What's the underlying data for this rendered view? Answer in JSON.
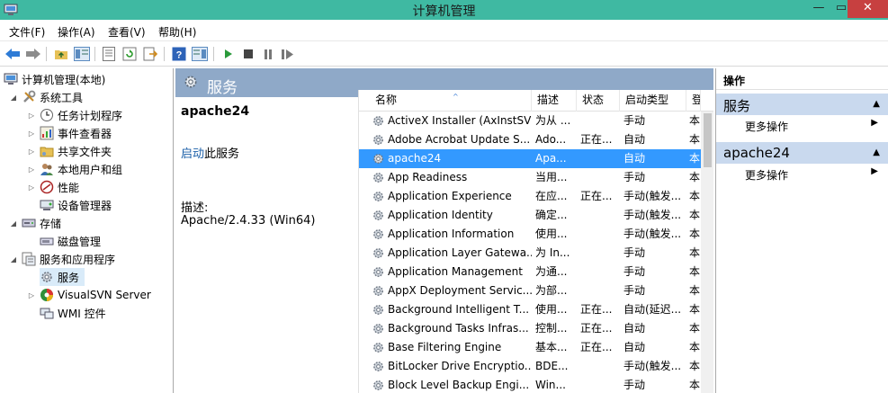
{
  "window": {
    "title": "计算机管理",
    "minimize_glyph": "—",
    "maximize_glyph": "▭",
    "close_glyph": "✕"
  },
  "menu": [
    "文件(F)",
    "操作(A)",
    "查看(V)",
    "帮助(H)"
  ],
  "toolbar_icons": [
    "back-icon",
    "forward-icon",
    "up-folder-icon",
    "show-hide-tree-icon",
    "properties-icon",
    "refresh-icon",
    "export-list-icon",
    "help-icon",
    "show-action-pane-icon",
    "start-service-icon",
    "stop-service-icon",
    "pause-service-icon",
    "restart-service-icon"
  ],
  "tree": {
    "root": "计算机管理(本地)",
    "system_tools": "系统工具",
    "task_scheduler": "任务计划程序",
    "event_viewer": "事件查看器",
    "shared_folders": "共享文件夹",
    "local_users": "本地用户和组",
    "performance": "性能",
    "device_manager": "设备管理器",
    "storage": "存储",
    "disk_management": "磁盘管理",
    "services_apps": "服务和应用程序",
    "services": "服务",
    "visualsvn": "VisualSVN Server",
    "wmi": "WMI 控件",
    "expanded_glyph": "◢",
    "collapsed_glyph": "▷"
  },
  "services_panel": {
    "header": "服务",
    "selected_name": "apache24",
    "start_link": "启动",
    "start_suffix": "此服务",
    "desc_label": "描述:",
    "desc": "Apache/2.4.33 (Win64)",
    "sort_glyph": "^",
    "columns": [
      "名称",
      "描述",
      "状态",
      "启动类型",
      "登"
    ],
    "rows": [
      {
        "name": "ActiveX Installer (AxInstSV)",
        "desc": "为从 ...",
        "status": "",
        "start": "手动",
        "login": "本"
      },
      {
        "name": "Adobe Acrobat Update S...",
        "desc": "Ado...",
        "status": "正在...",
        "start": "自动",
        "login": "本"
      },
      {
        "name": "apache24",
        "desc": "Apa...",
        "status": "",
        "start": "自动",
        "login": "本"
      },
      {
        "name": "App Readiness",
        "desc": "当用...",
        "status": "",
        "start": "手动",
        "login": "本"
      },
      {
        "name": "Application Experience",
        "desc": "在应...",
        "status": "正在...",
        "start": "手动(触发...",
        "login": "本"
      },
      {
        "name": "Application Identity",
        "desc": "确定...",
        "status": "",
        "start": "手动(触发...",
        "login": "本"
      },
      {
        "name": "Application Information",
        "desc": "使用...",
        "status": "",
        "start": "手动(触发...",
        "login": "本"
      },
      {
        "name": "Application Layer Gatewa...",
        "desc": "为 In...",
        "status": "",
        "start": "手动",
        "login": "本"
      },
      {
        "name": "Application Management",
        "desc": "为通...",
        "status": "",
        "start": "手动",
        "login": "本"
      },
      {
        "name": "AppX Deployment Servic...",
        "desc": "为部...",
        "status": "",
        "start": "手动",
        "login": "本"
      },
      {
        "name": "Background Intelligent T...",
        "desc": "使用...",
        "status": "正在...",
        "start": "自动(延迟...",
        "login": "本"
      },
      {
        "name": "Background Tasks Infras...",
        "desc": "控制...",
        "status": "正在...",
        "start": "自动",
        "login": "本"
      },
      {
        "name": "Base Filtering Engine",
        "desc": "基本...",
        "status": "正在...",
        "start": "自动",
        "login": "本"
      },
      {
        "name": "BitLocker Drive Encryptio...",
        "desc": "BDE...",
        "status": "",
        "start": "手动(触发...",
        "login": "本"
      },
      {
        "name": "Block Level Backup Engi...",
        "desc": "Win...",
        "status": "",
        "start": "手动",
        "login": "本"
      }
    ]
  },
  "actions": {
    "title": "操作",
    "section1": "服务",
    "section2": "apache24",
    "more": "更多操作",
    "collapse_glyph": "▲",
    "more_glyph": "▶"
  },
  "colors": {
    "titlebar": "#3fb9a2",
    "header": "#8fa9c8",
    "selection": "#3399ff",
    "action_section": "#c9d9ee"
  }
}
